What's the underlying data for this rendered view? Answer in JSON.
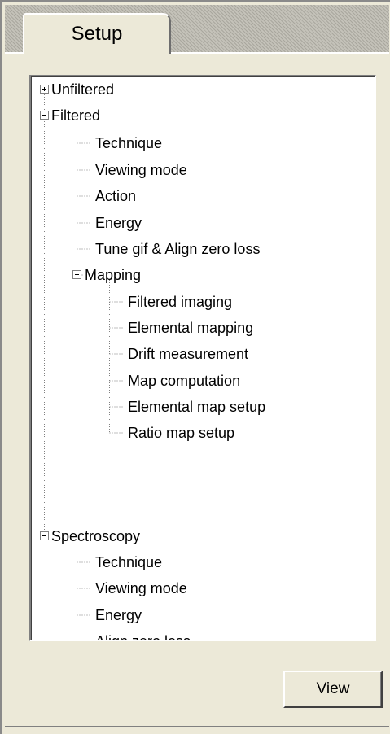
{
  "tabs": [
    {
      "label": "Setup",
      "active": true
    }
  ],
  "tree": [
    {
      "label": "Unfiltered",
      "expanded": false
    },
    {
      "label": "Filtered",
      "expanded": true
    },
    {
      "label": "Technique"
    },
    {
      "label": "Viewing mode"
    },
    {
      "label": "Action"
    },
    {
      "label": "Energy"
    },
    {
      "label": "Tune gif & Align zero loss"
    },
    {
      "label": "Mapping",
      "expanded": true
    },
    {
      "label": "Filtered imaging"
    },
    {
      "label": "Elemental mapping"
    },
    {
      "label": "Drift measurement"
    },
    {
      "label": "Map computation"
    },
    {
      "label": "Elemental map setup"
    },
    {
      "label": "Ratio map setup"
    },
    {
      "label": "Spectroscopy",
      "expanded": true
    },
    {
      "label": "Technique"
    },
    {
      "label": "Viewing mode"
    },
    {
      "label": "Energy"
    },
    {
      "label": "Align zero loss"
    }
  ],
  "buttons": {
    "view_label": "View"
  }
}
